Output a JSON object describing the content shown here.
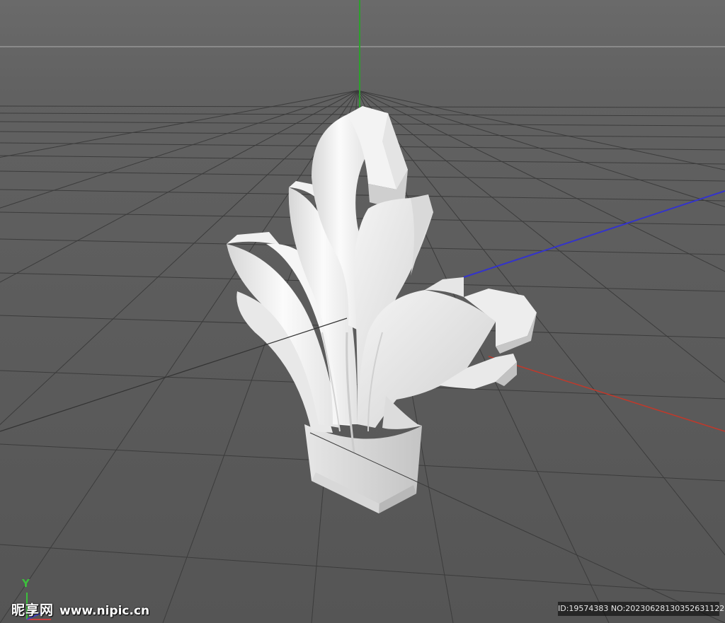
{
  "viewport": {
    "background_color": "#5f5f5f",
    "horizon_color": "#8a8a8a",
    "grid_color": "#3c3c3c",
    "axis_colors": {
      "x": "#c0392b",
      "y": "#2e9e2e",
      "z": "#3333cc"
    },
    "object": "white carved acanthus leaf ornament"
  },
  "axis_gizmo": {
    "y_label": "Y"
  },
  "watermark": {
    "brand": "昵享网",
    "url": "www.nipic.cn"
  },
  "image_id": "ID:19574383 NO:20230628130352631122"
}
